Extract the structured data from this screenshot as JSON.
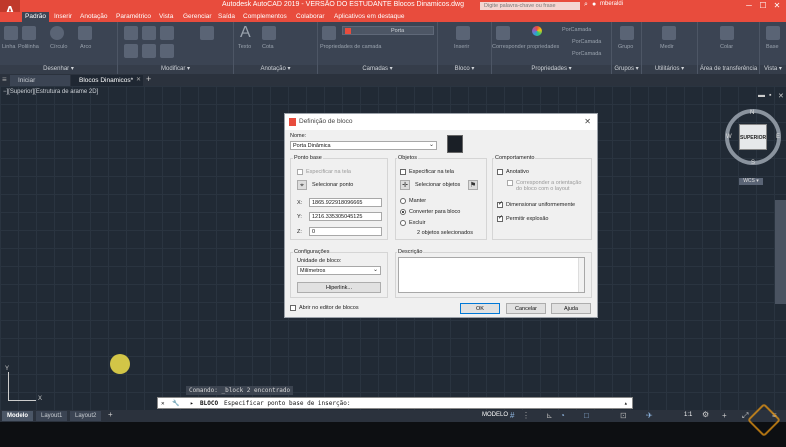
{
  "app": {
    "title": "Autodesk AutoCAD 2019 - VERSÃO DO ESTUDANTE    Blocos Dinamicos.dwg",
    "search_placeholder": "Digite palavra-chave ou frase",
    "user": "mberaldi",
    "logo_letter": "A",
    "brand_color": "#e84c3d"
  },
  "window_controls": {
    "minimize": "─",
    "maximize": "☐",
    "close": "✕"
  },
  "ribbon_tabs": [
    "Padrão",
    "Inserir",
    "Anotação",
    "Paramétrico",
    "Vista",
    "Gerenciar",
    "Saída",
    "Complementos",
    "Colaborar",
    "Aplicativos em destaque"
  ],
  "ribbon_groups": [
    "Desenhar ▾",
    "Modificar ▾",
    "Anotação ▾",
    "Camadas ▾",
    "Bloco ▾",
    "Propriedades ▾",
    "Grupos ▾",
    "Utilitários ▾",
    "Área de transferência",
    "Vista ▾"
  ],
  "ribbon_items": {
    "linha": "Linha",
    "polilinha": "Polilinha",
    "circulo": "Círculo",
    "arco": "Arco",
    "texto": "Texto",
    "cota": "Cota",
    "propriedades_camada": "Propriedades de camada",
    "inserir": "Inserir",
    "corresponder_propriedades": "Corresponder propriedades",
    "layer_name": "Porta",
    "porcamada1": "PorCamada",
    "porcamada2": "PorCamada",
    "porcamada3": "PorCamada",
    "grupo": "Grupo",
    "medir": "Medir",
    "colar": "Colar",
    "base": "Base"
  },
  "doc_tabs": [
    "Iniciar",
    "Blocos Dinamicos*"
  ],
  "doc_tab_add": "+",
  "viewport": {
    "label": "−][Superior][Estrutura de arame 2D]",
    "viewcube_face": "SUPERIOR",
    "compass": {
      "n": "N",
      "s": "S",
      "e": "E",
      "w": "W"
    },
    "wcs": "WCS ▾",
    "ucs_y": "Y",
    "ucs_x": "X"
  },
  "dialog": {
    "title": "Definição de bloco",
    "close": "✕",
    "name_label": "Nome:",
    "name_value": "Porta Dinâmica",
    "base_point": {
      "title": "Ponto base",
      "specify_on_screen": "Especificar na tela",
      "pick_point": "Selecionar ponto",
      "x_label": "X:",
      "x_value": "1865.922918096665",
      "y_label": "Y:",
      "y_value": "1216.335305045125",
      "z_label": "Z:",
      "z_value": "0"
    },
    "objects": {
      "title": "Objetos",
      "specify_on_screen": "Especificar na tela",
      "select_objects": "Selecionar objetos",
      "retain": "Manter",
      "convert": "Converter para bloco",
      "delete": "Excluir",
      "selected_count": "2 objetos selecionados"
    },
    "behavior": {
      "title": "Comportamento",
      "annotative": "Anotativo",
      "match_orientation": "Corresponder a orientação do bloco com o layout",
      "scale_uniform": "Dimensionar uniformemente",
      "allow_explode": "Permitir explosão"
    },
    "settings": {
      "title": "Configurações",
      "unit_label": "Unidade de bloco:",
      "unit_value": "Milímetros",
      "hyperlink": "Hiperlink..."
    },
    "description_label": "Descrição",
    "open_editor": "Abrir no editor de blocos",
    "ok": "OK",
    "cancel": "Cancelar",
    "help": "Ajuda"
  },
  "command": {
    "history": "Comando:  _block 2 encontrado",
    "prompt_cmd": "BLOCO",
    "prompt_text": "Especificar ponto base de inserção:"
  },
  "status": {
    "layout_tabs": [
      "Modelo",
      "Layout1",
      "Layout2"
    ],
    "add_layout": "+",
    "model_label": "MODELO",
    "scale": "1:1"
  }
}
